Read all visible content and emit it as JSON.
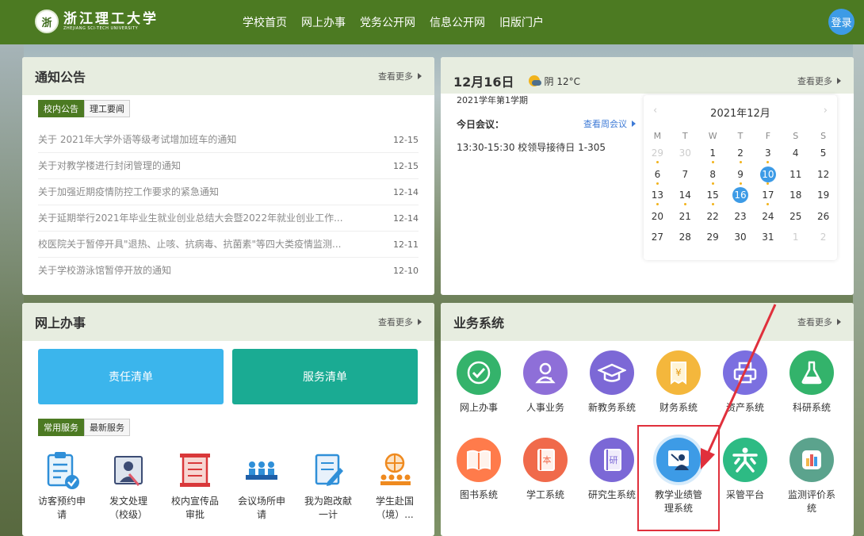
{
  "header": {
    "logo_mark": "浙",
    "logo_cn": "浙江理工大学",
    "logo_en": "ZHEJIANG SCI-TECH UNIVERSITY",
    "nav": [
      "学校首页",
      "网上办事",
      "党务公开网",
      "信息公开网",
      "旧版门户"
    ],
    "login": "登录",
    "brand_color": "#4c7a22"
  },
  "notice": {
    "title": "通知公告",
    "more": "查看更多",
    "tabs": [
      "校内公告",
      "理工要闻"
    ],
    "items": [
      {
        "text": "关于 2021年大学外语等级考试增加班车的通知",
        "date": "12-15"
      },
      {
        "text": "关于对教学楼进行封闭管理的通知",
        "date": "12-15"
      },
      {
        "text": "关于加强近期疫情防控工作要求的紧急通知",
        "date": "12-14"
      },
      {
        "text": "关于延期举行2021年毕业生就业创业总结大会暨2022年就业创业工作...",
        "date": "12-14"
      },
      {
        "text": "校医院关于暂停开具\"退热、止咳、抗病毒、抗菌素\"等四大类疫情监测...",
        "date": "12-11"
      },
      {
        "text": "关于学校游泳馆暂停开放的通知",
        "date": "12-10"
      }
    ]
  },
  "today": {
    "date": "12月16日",
    "weather": "阴 12°C",
    "weather_icon": "sun-cloud-icon",
    "term": "2021学年第1学期",
    "more": "查看更多",
    "meeting_label": "今日会议：",
    "week_link": "查看周会议",
    "meeting": "13:30-15:30 校领导接待日 1-305"
  },
  "calendar": {
    "title": "2021年12月",
    "prev": "‹",
    "next": "›",
    "weekdays": [
      "M",
      "T",
      "W",
      "T",
      "F",
      "S",
      "S"
    ],
    "weeks": [
      [
        "29",
        "30",
        "1",
        "2",
        "3",
        "4",
        "5"
      ],
      [
        "6",
        "7",
        "8",
        "9",
        "10",
        "11",
        "12"
      ],
      [
        "13",
        "14",
        "15",
        "16",
        "17",
        "18",
        "19"
      ],
      [
        "20",
        "21",
        "22",
        "23",
        "24",
        "25",
        "26"
      ],
      [
        "27",
        "28",
        "29",
        "30",
        "31",
        "1",
        "2"
      ]
    ]
  },
  "online": {
    "title": "网上办事",
    "more": "查看更多",
    "btn1": "责任清单",
    "btn2": "服务清单",
    "btn1_color": "#3bb5ec",
    "btn2_color": "#1aab93",
    "tabs": [
      "常用服务",
      "最新服务"
    ],
    "services": [
      [
        "访客预约申",
        "请"
      ],
      [
        "发文处理",
        "（校级）"
      ],
      [
        "校内宣传品",
        "审批"
      ],
      [
        "会议场所申",
        "请"
      ],
      [
        "我为跑改献",
        "一计"
      ],
      [
        "学生赴国",
        "（境）..."
      ]
    ]
  },
  "business": {
    "title": "业务系统",
    "more": "查看更多",
    "systems": [
      {
        "label": "网上办事",
        "color": "#34b36b",
        "icon": "check-circle-icon"
      },
      {
        "label": "人事业务",
        "color": "#8e6fd8",
        "icon": "person-icon"
      },
      {
        "label": "新教务系统",
        "color": "#7c68d6",
        "icon": "graduation-cap-icon"
      },
      {
        "label": "财务系统",
        "color": "#f4b73c",
        "icon": "receipt-icon"
      },
      {
        "label": "资产系统",
        "color": "#7b6fe0",
        "icon": "printer-icon"
      },
      {
        "label": "科研系统",
        "color": "#33b36b",
        "icon": "flask-icon"
      },
      {
        "label": "图书系统",
        "color": "#ff7b4b",
        "icon": "book-icon"
      },
      {
        "label": "学工系统",
        "color": "#f06a4b",
        "icon": "ben-book-icon"
      },
      {
        "label": "研究生系统",
        "color": "#7b68d6",
        "icon": "yan-book-icon"
      },
      {
        "label": "教学业绩管",
        "label2": "理系统",
        "color": "#3d9be6",
        "icon": "teacher-icon"
      },
      {
        "label": "采管平台",
        "color": "#2dbb84",
        "icon": "purchase-icon"
      },
      {
        "label": "监测评价系",
        "label2": "统",
        "color": "#5ba38d",
        "icon": "bar-chart-icon"
      }
    ]
  }
}
